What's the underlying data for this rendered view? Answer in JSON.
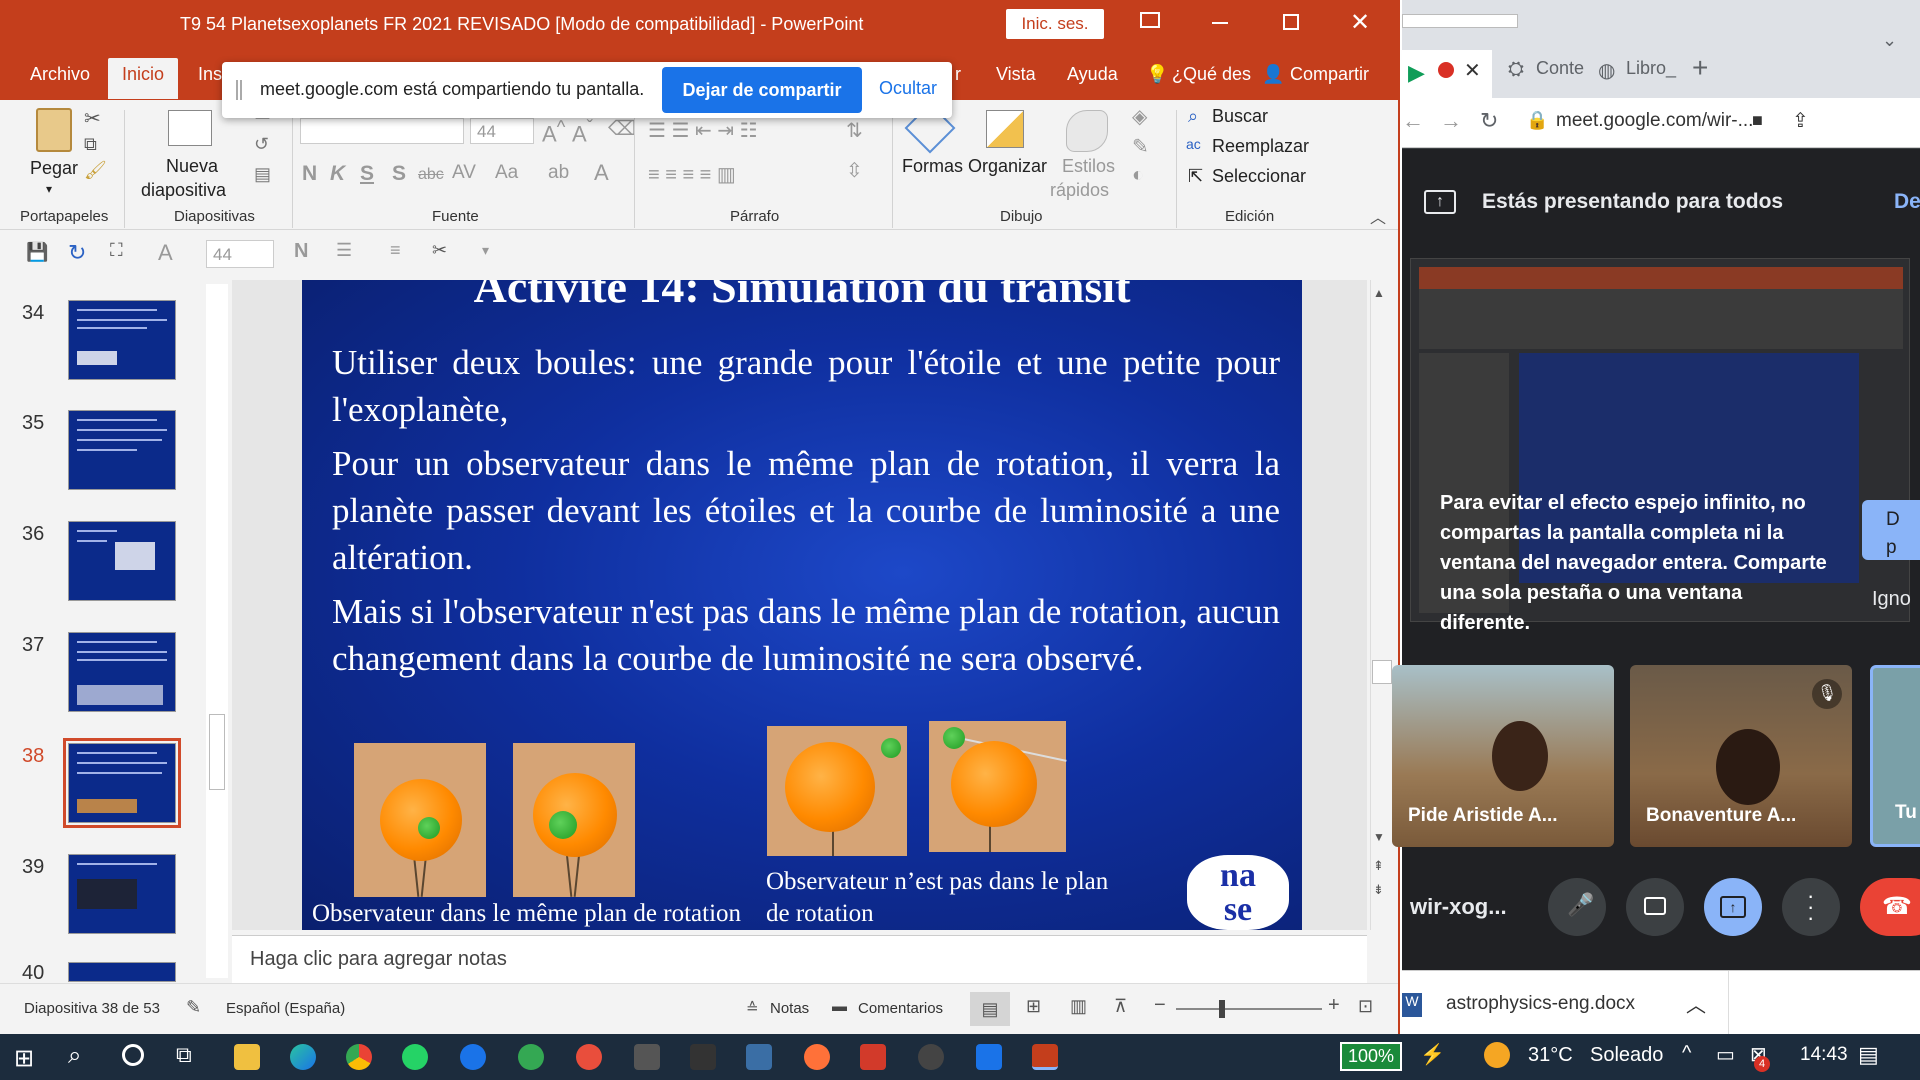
{
  "window": {
    "title": "T9 54 Planetsexoplanets FR 2021  REVISADO [Modo de compatibilidad]  -  PowerPoint",
    "signin": "Inic. ses."
  },
  "tabs": [
    "Archivo",
    "Inicio",
    "Ins",
    "r",
    "Vista",
    "Ayuda",
    "¿Qué des",
    "Compartir"
  ],
  "ribbon": {
    "paste": "Pegar",
    "new_slide_1": "Nueva",
    "new_slide_2": "diapositiva",
    "font_size": "44",
    "shapes": "Formas",
    "arrange": "Organizar",
    "styles_1": "Estilos",
    "styles_2": "rápidos",
    "find": "Buscar",
    "replace": "Reemplazar",
    "select": "Seleccionar",
    "groups": [
      "Portapapeles",
      "Diapositivas",
      "Fuente",
      "Párrafo",
      "Dibujo",
      "Edición"
    ]
  },
  "qat": {
    "font_size": "44"
  },
  "share_bar": {
    "message": "meet.google.com está compartiendo tu pantalla.",
    "stop": "Dejar de compartir",
    "hide": "Ocultar"
  },
  "thumbnails": [
    "34",
    "35",
    "36",
    "37",
    "38",
    "39",
    "40"
  ],
  "slide": {
    "title": "Activité 14: Simulation du transit",
    "p1": "Utiliser deux boules: une grande pour l'étoile et une petite pour l'exoplanète,",
    "p2": "Pour un observateur dans le même plan de rotation, il verra la planète passer devant les étoiles et la courbe de luminosité a une altération.",
    "p3": "Mais si l'observateur n'est pas dans le même plan de rotation, aucun changement dans la courbe de luminosité ne sera observé.",
    "cap_left": "Observateur dans le même plan de rotation",
    "cap_right_1": "Observateur n’est pas dans le plan",
    "cap_right_2": "de rotation",
    "logo_1": "na",
    "logo_2": "se"
  },
  "notes_placeholder": "Haga clic para agregar notas",
  "status": {
    "slide": "Diapositiva 38 de 53",
    "language": "Español (España)",
    "notes": "Notas",
    "comments": "Comentarios"
  },
  "chrome": {
    "tab1": "Conte",
    "tab2": "Libro_",
    "url": "meet.google.com/wir-...",
    "presenting": "Estás presentando para todos",
    "presenting_right": "De",
    "warning": "Para evitar el efecto espejo infinito, no compartas la pantalla completa ni la ventana del navegador entera. Comparte una sola pestaña o una ventana diferente.",
    "side_1": "D",
    "side_2": "p",
    "side_3": "Igno",
    "participants": [
      "Pide Aristide A...",
      "Bonaventure A...",
      "Tu"
    ],
    "meeting_code": "wir-xog...",
    "download": "astrophysics-eng.docx"
  },
  "taskbar": {
    "battery": "100%",
    "temp": "31°C",
    "weather": "Soleado",
    "time": "14:43",
    "badge": "4"
  }
}
